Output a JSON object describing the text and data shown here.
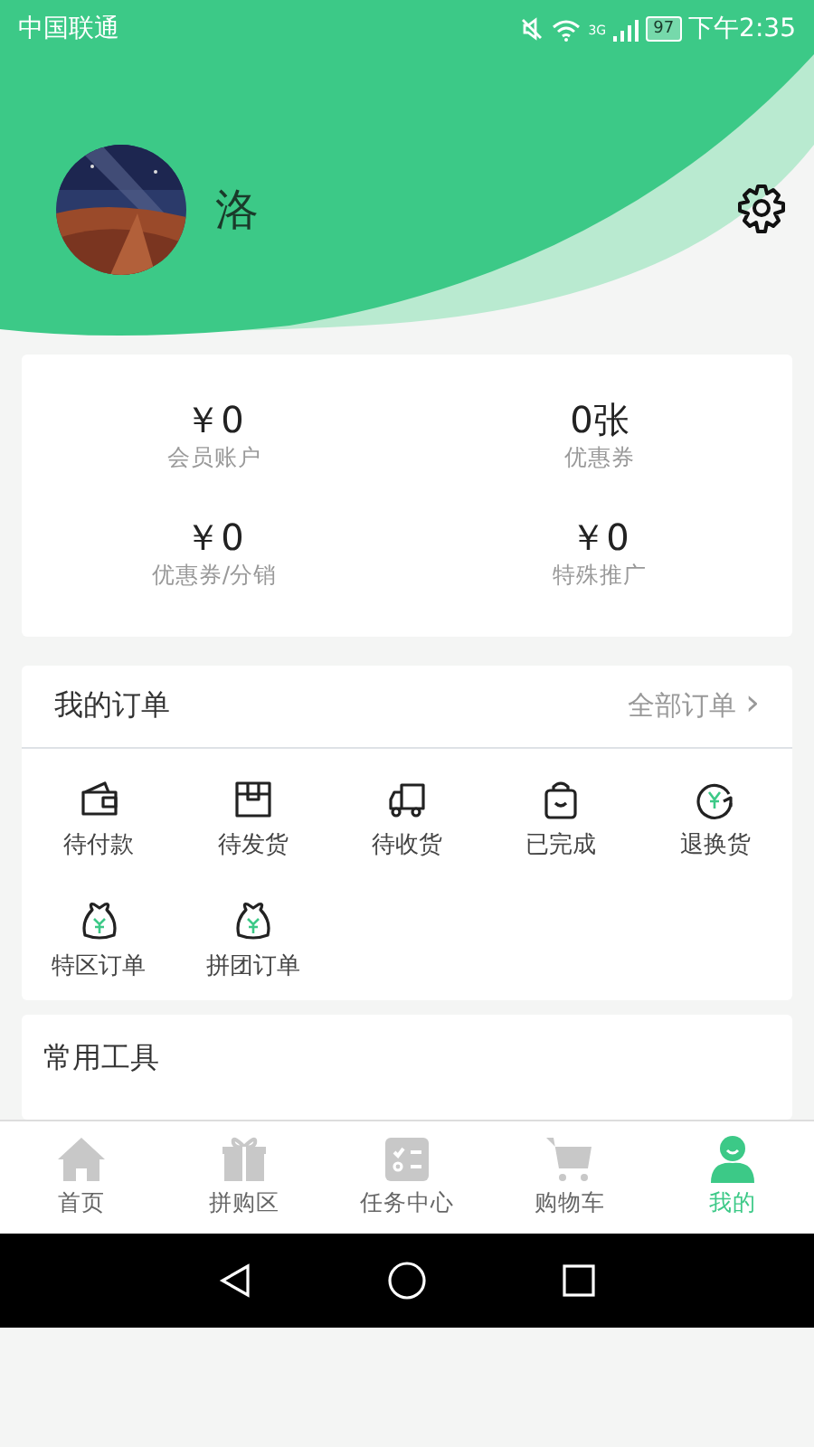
{
  "status_bar": {
    "carrier": "中国联通",
    "network": "3G",
    "battery": "97",
    "time": "下午2:35"
  },
  "profile": {
    "name": "洛"
  },
  "stats": [
    {
      "value": "￥0",
      "label": "会员账户"
    },
    {
      "value": "0张",
      "label": "优惠券"
    },
    {
      "value": "￥0",
      "label": "优惠券/分销"
    },
    {
      "value": "￥0",
      "label": "特殊推广"
    }
  ],
  "orders": {
    "title": "我的订单",
    "link": "全部订单",
    "chevron": "›",
    "items": [
      {
        "kind": "wallet",
        "label": "待付款"
      },
      {
        "kind": "box",
        "label": "待发货"
      },
      {
        "kind": "truck",
        "label": "待收货"
      },
      {
        "kind": "bag",
        "label": "已完成"
      },
      {
        "kind": "refund",
        "label": "退换货"
      },
      {
        "kind": "moneybag",
        "label": "特区订单"
      },
      {
        "kind": "moneybag",
        "label": "拼团订单"
      }
    ]
  },
  "tools": {
    "title": "常用工具"
  },
  "tabs": [
    {
      "kind": "home",
      "label": "首页",
      "selected": false
    },
    {
      "kind": "gift",
      "label": "拼购区",
      "selected": false
    },
    {
      "kind": "tasks",
      "label": "任务中心",
      "selected": false
    },
    {
      "kind": "cart",
      "label": "购物车",
      "selected": false
    },
    {
      "kind": "user",
      "label": "我的",
      "selected": true
    }
  ]
}
